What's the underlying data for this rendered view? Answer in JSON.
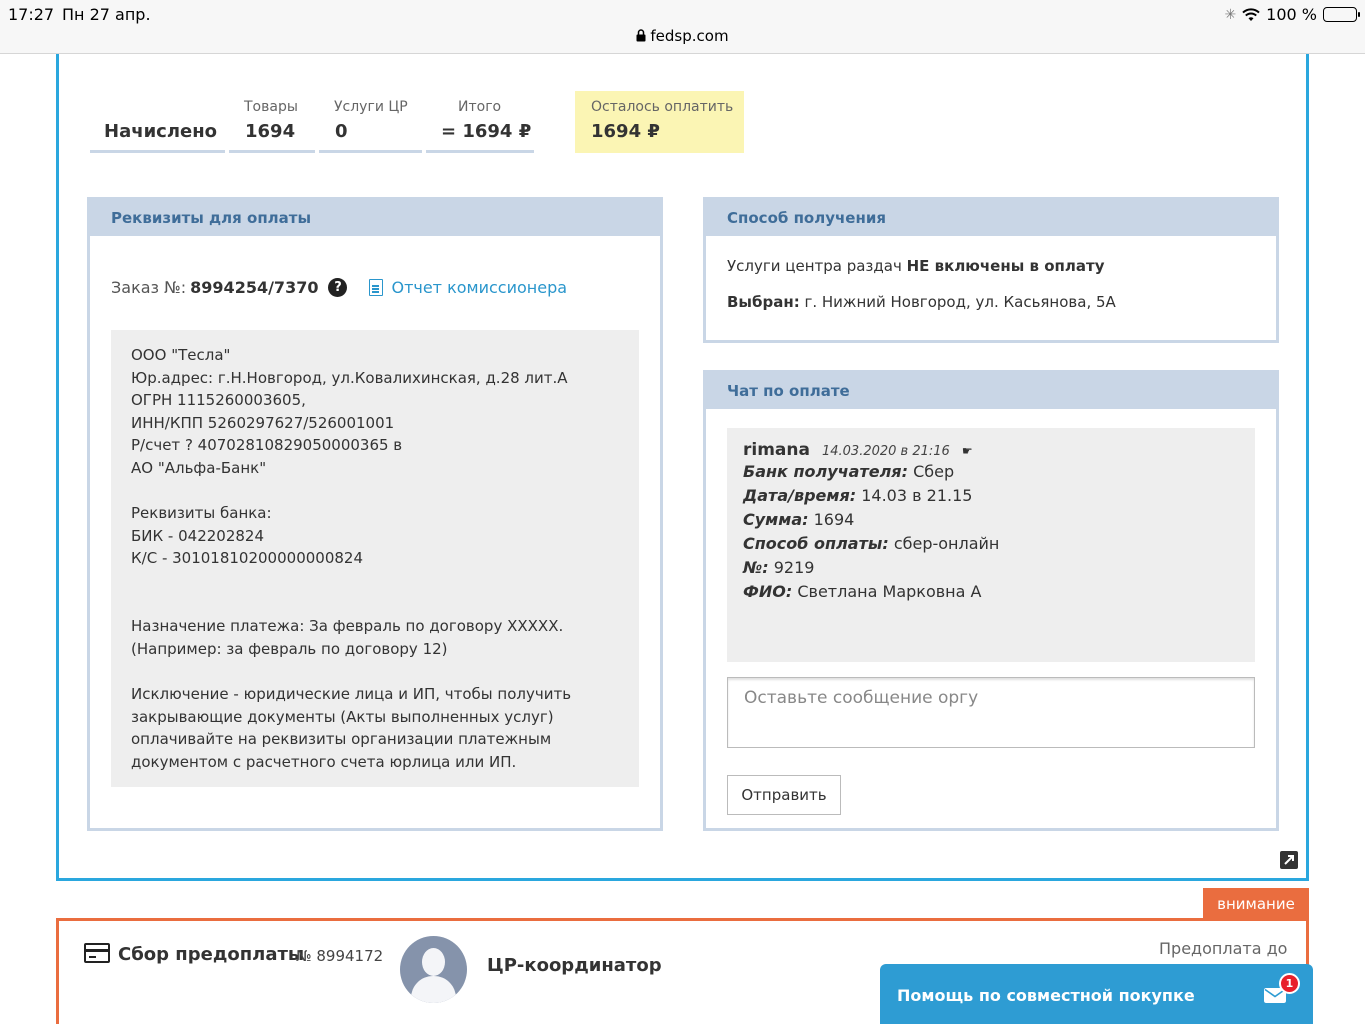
{
  "status_bar": {
    "time": "17:27",
    "date": "Пн 27 апр.",
    "battery": "100 %",
    "url": "fedsp.com"
  },
  "totals": {
    "charged_label": "Начислено",
    "goods_label": "Товары",
    "goods_value": "1694",
    "services_label": "Услуги ЦР",
    "services_value": "0",
    "total_label": "Итого",
    "total_value": "= 1694 ₽",
    "remaining_label": "Осталось оплатить",
    "remaining_value": "1694 ₽"
  },
  "requisites": {
    "title": "Реквизиты для оплаты",
    "order_label": "Заказ №:",
    "order_number": "8994254/7370",
    "report_link": "Отчет комиссионера",
    "lines": [
      "ООО \"Тесла\"",
      "Юр.адрес: г.Н.Новгород, ул.Ковалихинская, д.28 лит.А",
      "ОГРН 1115260003605,",
      "ИНН/КПП 5260297627/526001001",
      "Р/счет ? 40702810829050000365 в",
      "АО \"Альфа-Банк\"",
      "",
      "Реквизиты банка:",
      "БИК - 042202824",
      "К/С - 30101810200000000824",
      "",
      "",
      "Назначение платежа: За февраль по договору XXXXX.",
      "(Например: за февраль по договору 12)",
      "",
      "Исключение - юридические лица и ИП, чтобы получить",
      "закрывающие документы (Акты выполненных услуг)",
      "оплачивайте на реквизиты организации платежным",
      "документом с расчетного счета юрлица или ИП."
    ]
  },
  "delivery": {
    "title": "Способ получения",
    "services_prefix": "Услуги центра раздач",
    "services_bold": "НЕ включены в оплату",
    "selected_label": "Выбран:",
    "selected_value": "г. Нижний Новгород, ул. Касьянова, 5А"
  },
  "chat": {
    "title": "Чат по оплате",
    "message": {
      "user": "rimana",
      "timestamp": "14.03.2020 в 21:16",
      "flag": "☛",
      "fields": [
        {
          "label": "Банк получателя:",
          "value": "Сбер"
        },
        {
          "label": "Дата/время:",
          "value": "14.03 в 21.15"
        },
        {
          "label": "Сумма:",
          "value": "1694"
        },
        {
          "label": "Способ оплаты:",
          "value": "сбер-онлайн"
        },
        {
          "label": "№:",
          "value": "9219"
        },
        {
          "label": "ФИО:",
          "value": "Светлана Марковна А"
        }
      ]
    },
    "input_placeholder": "Оставьте сообщение оргу",
    "send_label": "Отправить"
  },
  "bottom": {
    "attention_label": "внимание",
    "prepay_title": "Сбор предоплаты",
    "prepay_number": "№ 8994172",
    "coordinator": "ЦР-координатор",
    "prepay_until": "Предоплата до"
  },
  "help_widget": {
    "label": "Помощь по совместной покупке",
    "badge_count": "1"
  }
}
